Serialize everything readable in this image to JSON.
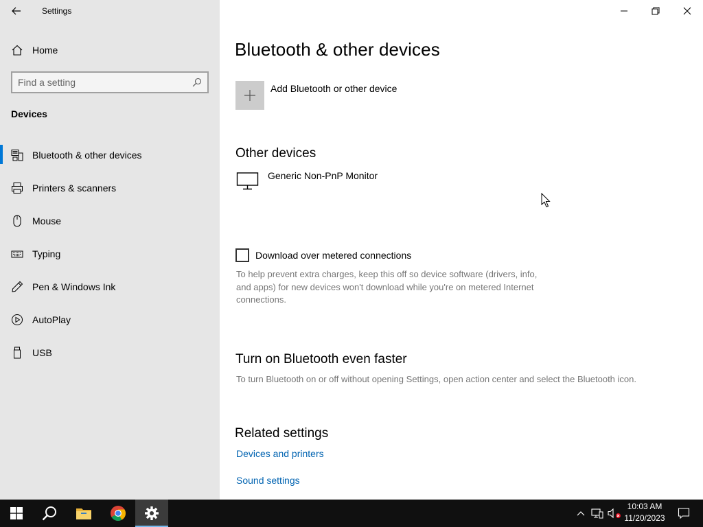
{
  "window": {
    "app_title": "Settings"
  },
  "sidebar": {
    "home_label": "Home",
    "search_placeholder": "Find a setting",
    "section_title": "Devices",
    "items": [
      {
        "label": "Bluetooth & other devices",
        "icon": "bluetooth-devices-icon",
        "selected": true
      },
      {
        "label": "Printers & scanners",
        "icon": "printer-icon",
        "selected": false
      },
      {
        "label": "Mouse",
        "icon": "mouse-icon",
        "selected": false
      },
      {
        "label": "Typing",
        "icon": "keyboard-icon",
        "selected": false
      },
      {
        "label": "Pen & Windows Ink",
        "icon": "pen-icon",
        "selected": false
      },
      {
        "label": "AutoPlay",
        "icon": "autoplay-icon",
        "selected": false
      },
      {
        "label": "USB",
        "icon": "usb-icon",
        "selected": false
      }
    ]
  },
  "main": {
    "title": "Bluetooth & other devices",
    "add_device_label": "Add Bluetooth or other device",
    "other_devices": {
      "heading": "Other devices",
      "devices": [
        {
          "name": "Generic Non-PnP Monitor",
          "icon": "monitor-icon"
        }
      ]
    },
    "metered": {
      "label": "Download over metered connections",
      "checked": false,
      "help": "To help prevent extra charges, keep this off so device software (drivers, info, and apps) for new devices won't download while you're on metered Internet connections."
    },
    "faster": {
      "heading": "Turn on Bluetooth even faster",
      "description": "To turn Bluetooth on or off without opening Settings, open action center and select the Bluetooth icon."
    },
    "related": {
      "heading": "Related settings",
      "links": [
        "Devices and printers",
        "Sound settings"
      ]
    }
  },
  "taskbar": {
    "apps": [
      "start-icon",
      "search-icon",
      "file-explorer-icon",
      "chrome-icon",
      "settings-icon"
    ],
    "active_app": "settings-icon",
    "clock": {
      "time": "10:03 AM",
      "date": "11/20/2023"
    }
  },
  "colors": {
    "accent": "#0078d7",
    "link": "#0063b1",
    "sidebar_bg": "#e6e6e6",
    "taskbar_bg": "#101010",
    "secondary_text": "#767676"
  }
}
